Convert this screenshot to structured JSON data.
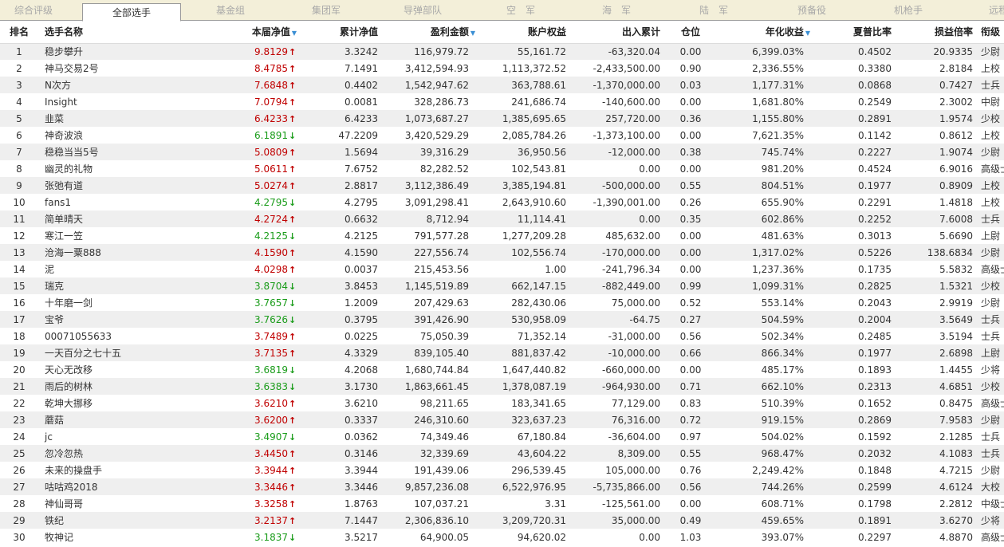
{
  "tabs": [
    {
      "label": "综合评级",
      "active": false
    },
    {
      "label": "全部选手",
      "active": true
    },
    {
      "label": "基金组",
      "active": false
    },
    {
      "label": "集团军",
      "active": false
    },
    {
      "label": "导弹部队",
      "active": false
    },
    {
      "label": "空　军",
      "active": false
    },
    {
      "label": "海　军",
      "active": false
    },
    {
      "label": "陆　军",
      "active": false
    },
    {
      "label": "预备役",
      "active": false
    },
    {
      "label": "机枪手",
      "active": false
    },
    {
      "label": "远程",
      "active": false
    }
  ],
  "columns": [
    {
      "label": "排名",
      "sortable": false
    },
    {
      "label": "选手名称",
      "sortable": false
    },
    {
      "label": "本届净值",
      "sortable": true
    },
    {
      "label": "累计净值",
      "sortable": false
    },
    {
      "label": "盈利金额",
      "sortable": true
    },
    {
      "label": "账户权益",
      "sortable": false
    },
    {
      "label": "出入累计",
      "sortable": false
    },
    {
      "label": "仓位",
      "sortable": false
    },
    {
      "label": "年化收益",
      "sortable": true
    },
    {
      "label": "夏普比率",
      "sortable": false
    },
    {
      "label": "损益倍率",
      "sortable": false
    },
    {
      "label": "衔级",
      "sortable": false
    }
  ],
  "sort_indicator": "▼",
  "arrows": {
    "up": "🠅",
    "down": "🠇"
  },
  "colors": {
    "up": "#c00000",
    "down": "#1a9c1a",
    "sort": "#3b8fd4"
  },
  "rows": [
    {
      "rank": "1",
      "name": "稳步攀升",
      "nav": "9.8129",
      "dir": "up",
      "cum": "3.3242",
      "profit": "116,979.72",
      "equity": "55,161.72",
      "flow": "-63,320.04",
      "pos": "0.00",
      "annual": "6,399.03%",
      "sharpe": "0.4502",
      "pl": "20.9335",
      "title": "少尉"
    },
    {
      "rank": "2",
      "name": "神马交易2号",
      "nav": "8.4785",
      "dir": "up",
      "cum": "7.1491",
      "profit": "3,412,594.93",
      "equity": "1,113,372.52",
      "flow": "-2,433,500.00",
      "pos": "0.90",
      "annual": "2,336.55%",
      "sharpe": "0.3380",
      "pl": "2.8184",
      "title": "上校"
    },
    {
      "rank": "3",
      "name": "N次方",
      "nav": "7.6848",
      "dir": "up",
      "cum": "0.4402",
      "profit": "1,542,947.62",
      "equity": "363,788.61",
      "flow": "-1,370,000.00",
      "pos": "0.03",
      "annual": "1,177.31%",
      "sharpe": "0.0868",
      "pl": "0.7427",
      "title": "士兵"
    },
    {
      "rank": "4",
      "name": "Insight",
      "nav": "7.0794",
      "dir": "up",
      "cum": "0.0081",
      "profit": "328,286.73",
      "equity": "241,686.74",
      "flow": "-140,600.00",
      "pos": "0.00",
      "annual": "1,681.80%",
      "sharpe": "0.2549",
      "pl": "2.3002",
      "title": "中尉"
    },
    {
      "rank": "5",
      "name": "韭菜",
      "nav": "6.4233",
      "dir": "up",
      "cum": "6.4233",
      "profit": "1,073,687.27",
      "equity": "1,385,695.65",
      "flow": "257,720.00",
      "pos": "0.36",
      "annual": "1,155.80%",
      "sharpe": "0.2891",
      "pl": "1.9574",
      "title": "少校"
    },
    {
      "rank": "6",
      "name": "神奇波浪",
      "nav": "6.1891",
      "dir": "down",
      "cum": "47.2209",
      "profit": "3,420,529.29",
      "equity": "2,085,784.26",
      "flow": "-1,373,100.00",
      "pos": "0.00",
      "annual": "7,621.35%",
      "sharpe": "0.1142",
      "pl": "0.8612",
      "title": "上校"
    },
    {
      "rank": "7",
      "name": "稳稳当当5号",
      "nav": "5.0809",
      "dir": "up",
      "cum": "1.5694",
      "profit": "39,316.29",
      "equity": "36,950.56",
      "flow": "-12,000.00",
      "pos": "0.38",
      "annual": "745.74%",
      "sharpe": "0.2227",
      "pl": "1.9074",
      "title": "少尉"
    },
    {
      "rank": "8",
      "name": "幽灵的礼物",
      "nav": "5.0611",
      "dir": "up",
      "cum": "7.6752",
      "profit": "82,282.52",
      "equity": "102,543.81",
      "flow": "0.00",
      "pos": "0.00",
      "annual": "981.20%",
      "sharpe": "0.4524",
      "pl": "6.9016",
      "title": "高级士官"
    },
    {
      "rank": "9",
      "name": "张弛有道",
      "nav": "5.0274",
      "dir": "up",
      "cum": "2.8817",
      "profit": "3,112,386.49",
      "equity": "3,385,194.81",
      "flow": "-500,000.00",
      "pos": "0.55",
      "annual": "804.51%",
      "sharpe": "0.1977",
      "pl": "0.8909",
      "title": "上校"
    },
    {
      "rank": "10",
      "name": "fans1",
      "nav": "4.2795",
      "dir": "down",
      "cum": "4.2795",
      "profit": "3,091,298.41",
      "equity": "2,643,910.60",
      "flow": "-1,390,001.00",
      "pos": "0.26",
      "annual": "655.90%",
      "sharpe": "0.2291",
      "pl": "1.4818",
      "title": "上校"
    },
    {
      "rank": "11",
      "name": "简单晴天",
      "nav": "4.2724",
      "dir": "up",
      "cum": "0.6632",
      "profit": "8,712.94",
      "equity": "11,114.41",
      "flow": "0.00",
      "pos": "0.35",
      "annual": "602.86%",
      "sharpe": "0.2252",
      "pl": "7.6008",
      "title": "士兵"
    },
    {
      "rank": "12",
      "name": "寒江一笠",
      "nav": "4.2125",
      "dir": "down",
      "cum": "4.2125",
      "profit": "791,577.28",
      "equity": "1,277,209.28",
      "flow": "485,632.00",
      "pos": "0.00",
      "annual": "481.63%",
      "sharpe": "0.3013",
      "pl": "5.6690",
      "title": "上尉"
    },
    {
      "rank": "13",
      "name": "沧海一粟888",
      "nav": "4.1590",
      "dir": "up",
      "cum": "4.1590",
      "profit": "227,556.74",
      "equity": "102,556.74",
      "flow": "-170,000.00",
      "pos": "0.00",
      "annual": "1,317.02%",
      "sharpe": "0.5226",
      "pl": "138.6834",
      "title": "少尉"
    },
    {
      "rank": "14",
      "name": "泥",
      "nav": "4.0298",
      "dir": "up",
      "cum": "0.0037",
      "profit": "215,453.56",
      "equity": "1.00",
      "flow": "-241,796.34",
      "pos": "0.00",
      "annual": "1,237.36%",
      "sharpe": "0.1735",
      "pl": "5.5832",
      "title": "高级士官"
    },
    {
      "rank": "15",
      "name": "瑞克",
      "nav": "3.8704",
      "dir": "down",
      "cum": "3.8453",
      "profit": "1,145,519.89",
      "equity": "662,147.15",
      "flow": "-882,449.00",
      "pos": "0.99",
      "annual": "1,099.31%",
      "sharpe": "0.2825",
      "pl": "1.5321",
      "title": "少校"
    },
    {
      "rank": "16",
      "name": "十年磨一剑",
      "nav": "3.7657",
      "dir": "down",
      "cum": "1.2009",
      "profit": "207,429.63",
      "equity": "282,430.06",
      "flow": "75,000.00",
      "pos": "0.52",
      "annual": "553.14%",
      "sharpe": "0.2043",
      "pl": "2.9919",
      "title": "少尉"
    },
    {
      "rank": "17",
      "name": "宝爷",
      "nav": "3.7626",
      "dir": "down",
      "cum": "0.3795",
      "profit": "391,426.90",
      "equity": "530,958.09",
      "flow": "-64.75",
      "pos": "0.27",
      "annual": "504.59%",
      "sharpe": "0.2004",
      "pl": "3.5649",
      "title": "士兵"
    },
    {
      "rank": "18",
      "name": "00071055633",
      "nav": "3.7489",
      "dir": "up",
      "cum": "0.0225",
      "profit": "75,050.39",
      "equity": "71,352.14",
      "flow": "-31,000.00",
      "pos": "0.56",
      "annual": "502.34%",
      "sharpe": "0.2485",
      "pl": "3.5194",
      "title": "士兵"
    },
    {
      "rank": "19",
      "name": "一天百分之七十五",
      "nav": "3.7135",
      "dir": "up",
      "cum": "4.3329",
      "profit": "839,105.40",
      "equity": "881,837.42",
      "flow": "-10,000.00",
      "pos": "0.66",
      "annual": "866.34%",
      "sharpe": "0.1977",
      "pl": "2.6898",
      "title": "上尉"
    },
    {
      "rank": "20",
      "name": "天心无改移",
      "nav": "3.6819",
      "dir": "down",
      "cum": "4.2068",
      "profit": "1,680,744.84",
      "equity": "1,647,440.82",
      "flow": "-660,000.00",
      "pos": "0.00",
      "annual": "485.17%",
      "sharpe": "0.1893",
      "pl": "1.4455",
      "title": "少将"
    },
    {
      "rank": "21",
      "name": "雨后的树林",
      "nav": "3.6383",
      "dir": "down",
      "cum": "3.1730",
      "profit": "1,863,661.45",
      "equity": "1,378,087.19",
      "flow": "-964,930.00",
      "pos": "0.71",
      "annual": "662.10%",
      "sharpe": "0.2313",
      "pl": "4.6851",
      "title": "少校"
    },
    {
      "rank": "22",
      "name": "乾坤大挪移",
      "nav": "3.6210",
      "dir": "up",
      "cum": "3.6210",
      "profit": "98,211.65",
      "equity": "183,341.65",
      "flow": "77,129.00",
      "pos": "0.83",
      "annual": "510.39%",
      "sharpe": "0.1652",
      "pl": "0.8475",
      "title": "高级士官"
    },
    {
      "rank": "23",
      "name": "蘑菇",
      "nav": "3.6200",
      "dir": "up",
      "cum": "0.3337",
      "profit": "246,310.60",
      "equity": "323,637.23",
      "flow": "76,316.00",
      "pos": "0.72",
      "annual": "919.15%",
      "sharpe": "0.2869",
      "pl": "7.9583",
      "title": "少尉"
    },
    {
      "rank": "24",
      "name": "jc",
      "nav": "3.4907",
      "dir": "down",
      "cum": "0.0362",
      "profit": "74,349.46",
      "equity": "67,180.84",
      "flow": "-36,604.00",
      "pos": "0.97",
      "annual": "504.02%",
      "sharpe": "0.1592",
      "pl": "2.1285",
      "title": "士兵"
    },
    {
      "rank": "25",
      "name": "忽冷忽热",
      "nav": "3.4450",
      "dir": "up",
      "cum": "0.3146",
      "profit": "32,339.69",
      "equity": "43,604.22",
      "flow": "8,309.00",
      "pos": "0.55",
      "annual": "968.47%",
      "sharpe": "0.2032",
      "pl": "4.1083",
      "title": "士兵"
    },
    {
      "rank": "26",
      "name": "未来的操盘手",
      "nav": "3.3944",
      "dir": "up",
      "cum": "3.3944",
      "profit": "191,439.06",
      "equity": "296,539.45",
      "flow": "105,000.00",
      "pos": "0.76",
      "annual": "2,249.42%",
      "sharpe": "0.1848",
      "pl": "4.7215",
      "title": "少尉"
    },
    {
      "rank": "27",
      "name": "咕咕鸡2018",
      "nav": "3.3446",
      "dir": "up",
      "cum": "3.3446",
      "profit": "9,857,236.08",
      "equity": "6,522,976.95",
      "flow": "-5,735,866.00",
      "pos": "0.56",
      "annual": "744.26%",
      "sharpe": "0.2599",
      "pl": "4.6124",
      "title": "大校"
    },
    {
      "rank": "28",
      "name": "神仙哥哥",
      "nav": "3.3258",
      "dir": "up",
      "cum": "1.8763",
      "profit": "107,037.21",
      "equity": "3.31",
      "flow": "-125,561.00",
      "pos": "0.00",
      "annual": "608.71%",
      "sharpe": "0.1798",
      "pl": "2.2812",
      "title": "中级士官"
    },
    {
      "rank": "29",
      "name": "铁纪",
      "nav": "3.2137",
      "dir": "up",
      "cum": "7.1447",
      "profit": "2,306,836.10",
      "equity": "3,209,720.31",
      "flow": "35,000.00",
      "pos": "0.49",
      "annual": "459.65%",
      "sharpe": "0.1891",
      "pl": "3.6270",
      "title": "少将"
    },
    {
      "rank": "30",
      "name": "牧神记",
      "nav": "3.1837",
      "dir": "down",
      "cum": "3.5217",
      "profit": "64,900.05",
      "equity": "94,620.02",
      "flow": "0.00",
      "pos": "1.03",
      "annual": "393.07%",
      "sharpe": "0.2297",
      "pl": "4.8870",
      "title": "高级士官"
    }
  ]
}
